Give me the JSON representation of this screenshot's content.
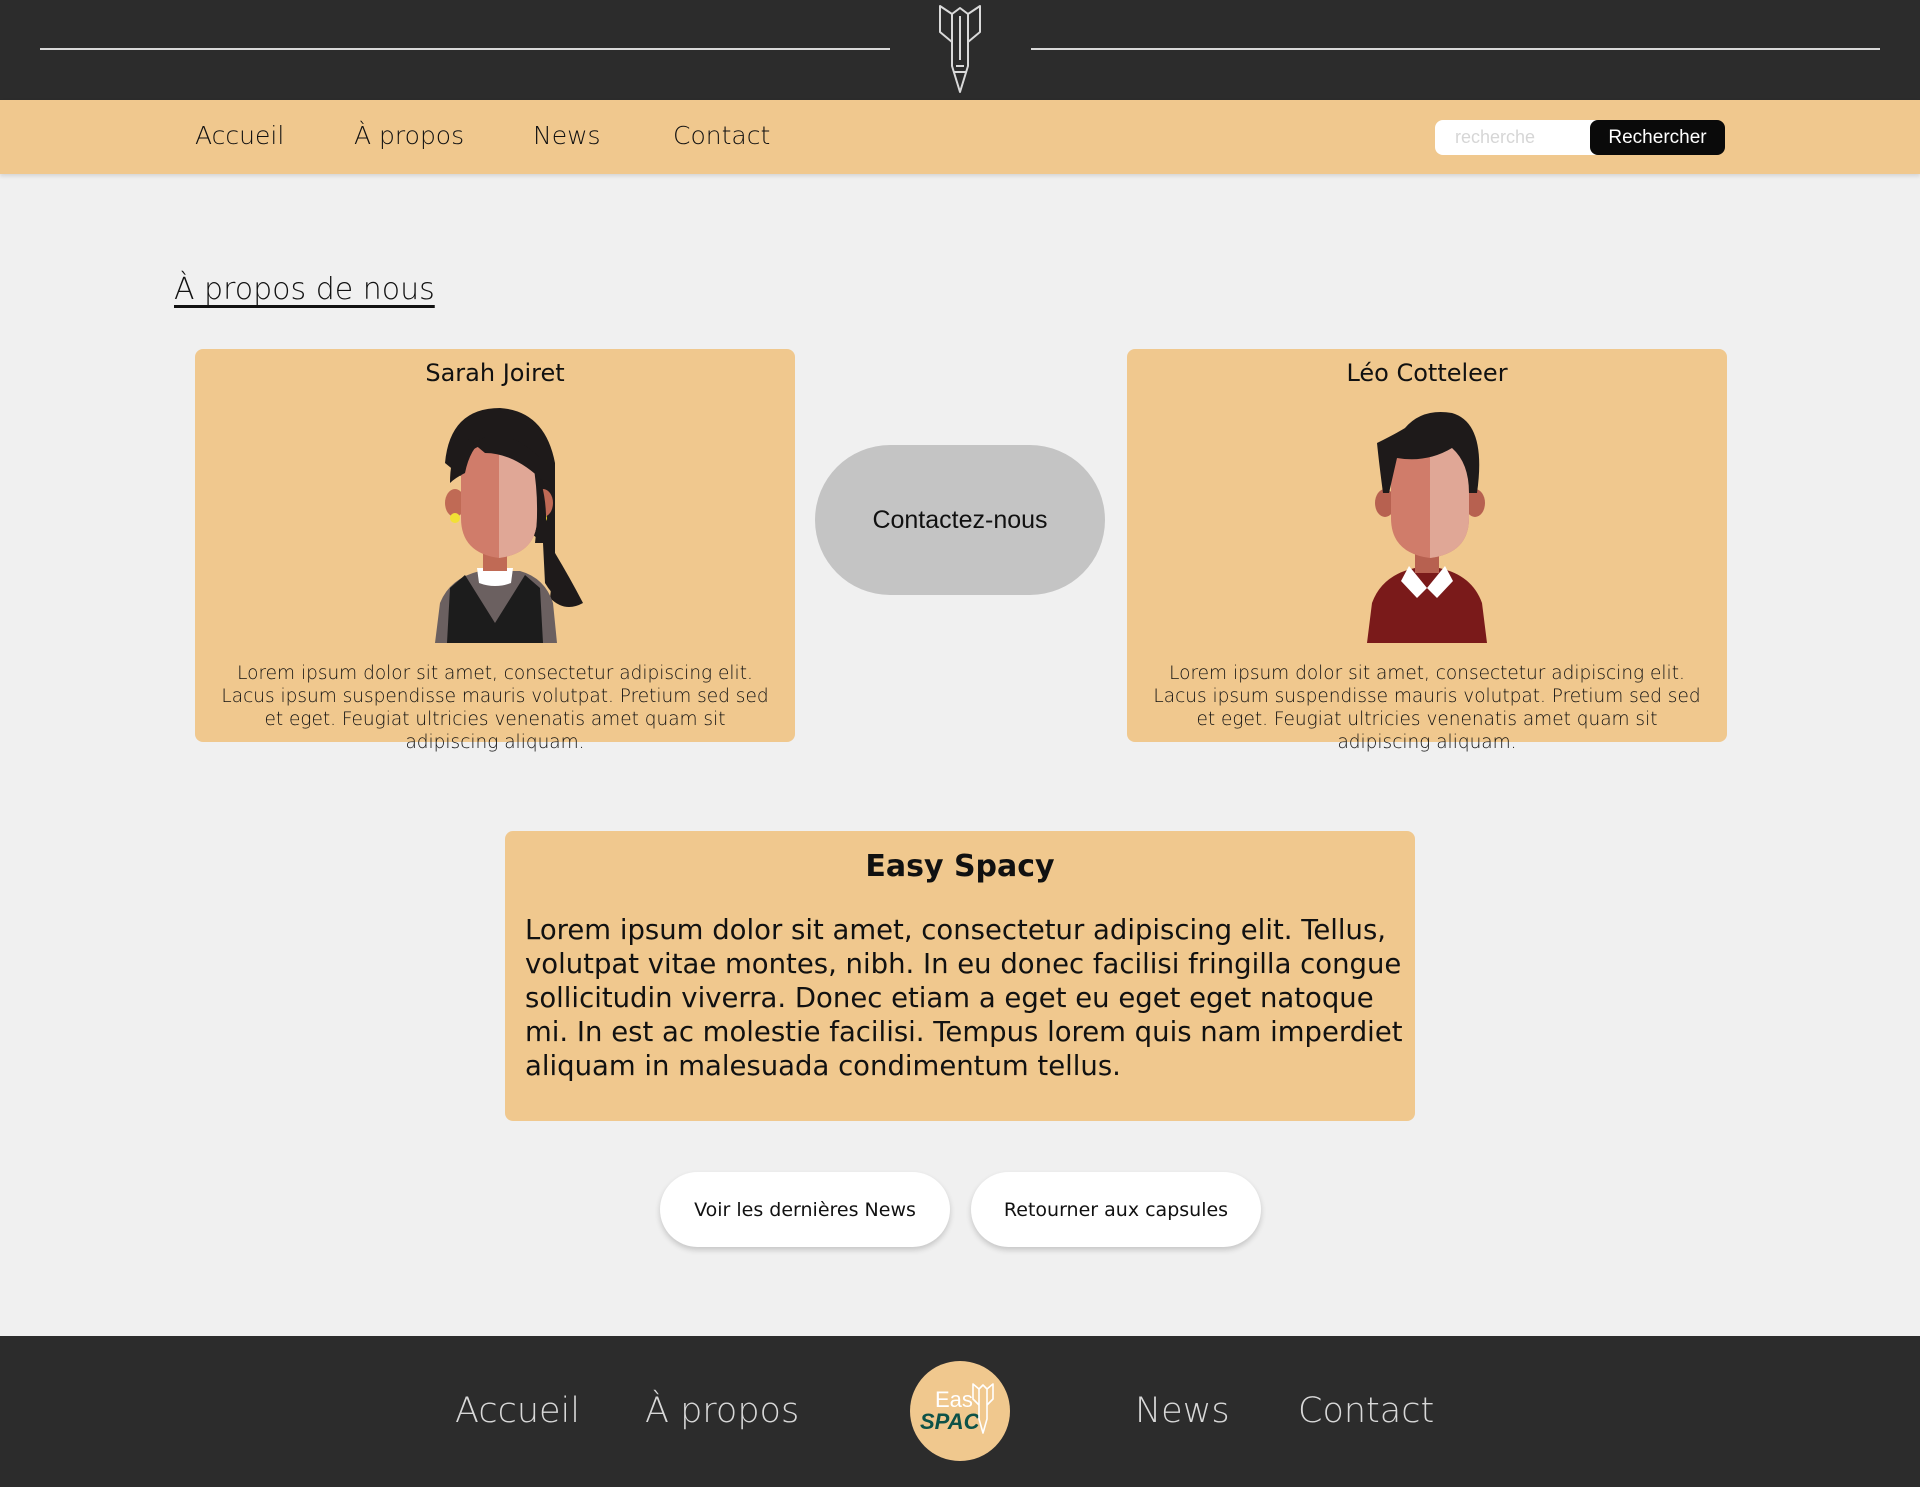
{
  "nav": {
    "items": [
      "Accueil",
      "À propos",
      "News",
      "Contact"
    ]
  },
  "search": {
    "placeholder": "recherche",
    "button_label": "Rechercher"
  },
  "page": {
    "title": "À propos de nous"
  },
  "team": [
    {
      "name": "Sarah Joiret",
      "bio": "Lorem ipsum dolor sit amet, consectetur adipiscing elit. Lacus ipsum suspendisse mauris volutpat. Pretium sed sed et eget. Feugiat ultricies venenatis amet quam sit adipiscing aliquam."
    },
    {
      "name": "Léo Cotteleer",
      "bio": "Lorem ipsum dolor sit amet, consectetur adipiscing elit. Lacus ipsum suspendisse mauris volutpat. Pretium sed sed et eget. Feugiat ultricies venenatis amet quam sit adipiscing aliquam."
    }
  ],
  "contact_button": "Contactez-nous",
  "about": {
    "title": "Easy Spacy",
    "text": "Lorem ipsum dolor sit amet, consectetur adipiscing elit. Tellus, volutpat vitae montes, nibh. In eu donec facilisi fringilla congue sollicitudin viverra. Donec etiam a eget eu eget eget natoque mi. In est ac molestie facilisi. Tempus lorem quis nam imperdiet aliquam in malesuada condimentum tellus."
  },
  "actions": {
    "news": "Voir les dernières News",
    "capsules": "Retourner aux capsules"
  },
  "footer": {
    "items": [
      "Accueil",
      "À propos",
      "News",
      "Contact"
    ],
    "logo_top": "Eas",
    "logo_bottom": "SPAC"
  },
  "colors": {
    "header_bg": "#2c2c2c",
    "accent": "#f0c88e",
    "page_bg": "#f0f0f0",
    "pill": "#c4c4c4"
  },
  "icons": {
    "header_logo": "rocket-icon",
    "footer_logo": "easy-spacy-logo"
  }
}
